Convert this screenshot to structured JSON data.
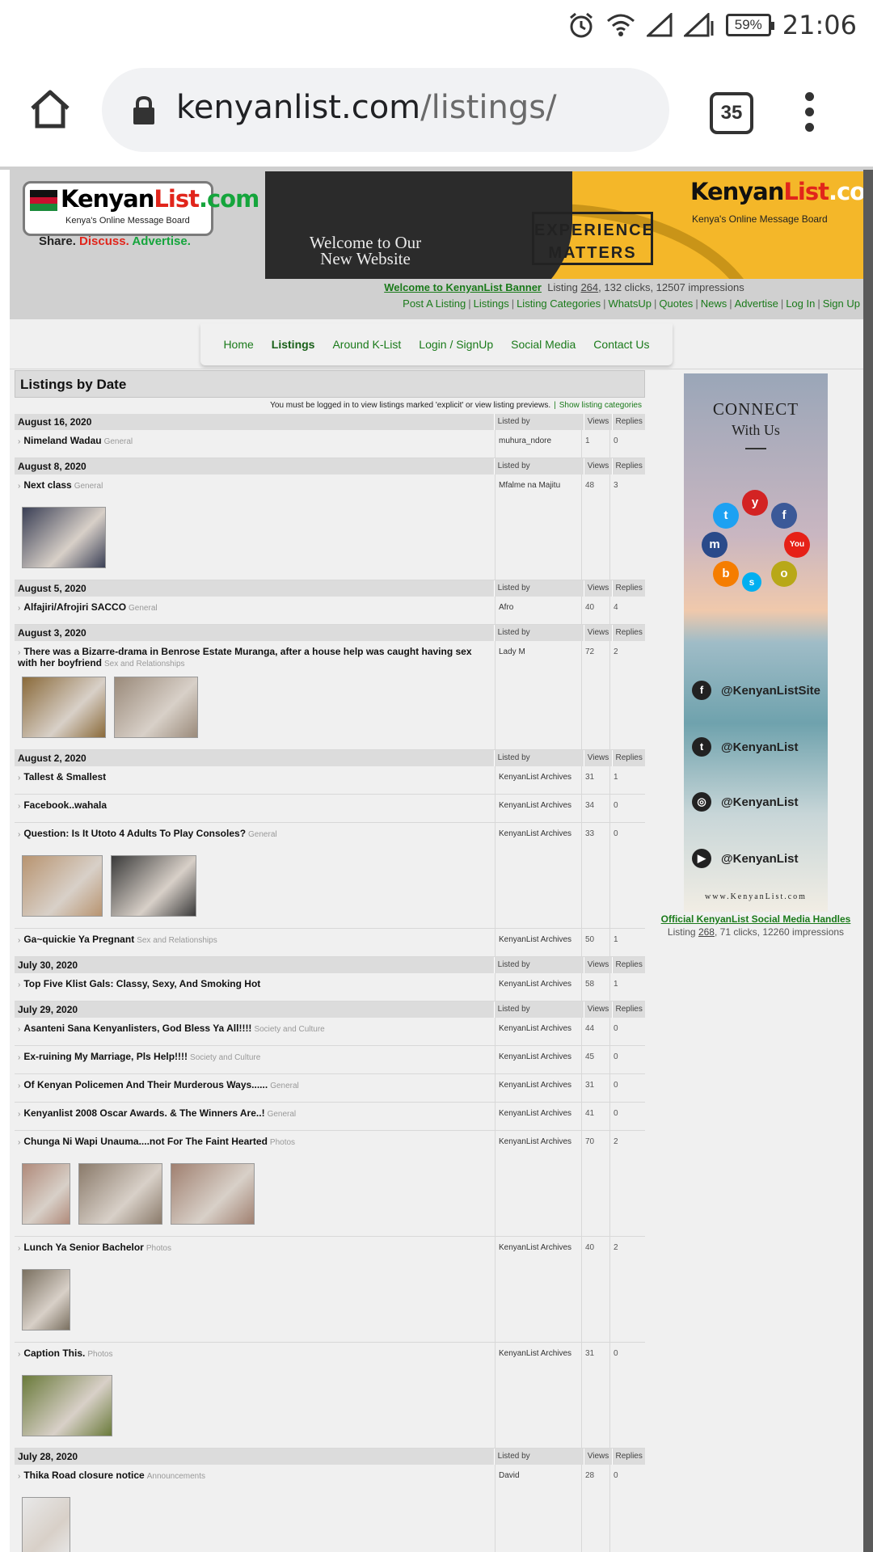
{
  "status_bar": {
    "battery": "59%",
    "time": "21:06"
  },
  "browser": {
    "url_domain": "kenyanlist.com",
    "url_path": "/listings/",
    "tab_count": "35"
  },
  "header": {
    "logo_left": "Kenyan",
    "logo_mid": "List",
    "logo_right": ".com",
    "logo_subtitle": "Kenya's Online Message Board",
    "tagline_share": "Share.",
    "tagline_discuss": "Discuss.",
    "tagline_advertise": "Advertise.",
    "banner": {
      "welcome": "Welcome to Our New Website",
      "experience": "EXPERIENCE MATTERS",
      "logo_left": "Kenyan",
      "logo_mid": "List",
      "logo_right": ".com",
      "subtitle": "Kenya's Online Message Board"
    },
    "banner_link": "Welcome to KenyanList Banner",
    "banner_stats_prefix": "Listing ",
    "banner_listing_no": "264",
    "banner_stats_suffix": ", 132 clicks, 12507 impressions",
    "top_links": [
      "Post A Listing",
      "Listings",
      "Listing Categories",
      "WhatsUp",
      "Quotes",
      "News",
      "Advertise",
      "Log In",
      "Sign Up"
    ]
  },
  "nav": [
    {
      "label": "Home",
      "active": false
    },
    {
      "label": "Listings",
      "active": true
    },
    {
      "label": "Around K-List",
      "active": false
    },
    {
      "label": "Login / SignUp",
      "active": false
    },
    {
      "label": "Social Media",
      "active": false
    },
    {
      "label": "Contact Us",
      "active": false
    }
  ],
  "listings": {
    "title": "Listings by Date",
    "notice": "You must be logged in to view listings marked 'explicit' or view listing previews.",
    "notice_link": "Show listing categories",
    "col_listed_by": "Listed by",
    "col_views": "Views",
    "col_replies": "Replies",
    "groups": [
      {
        "date": "August 16, 2020",
        "items": [
          {
            "title": "Nimeland Wadau",
            "category": "General",
            "by": "muhura_ndore",
            "views": "1",
            "replies": "0",
            "thumbs": []
          }
        ]
      },
      {
        "date": "August 8, 2020",
        "items": [
          {
            "title": "Next class",
            "category": "General",
            "by": "Mfalme na Majitu",
            "views": "48",
            "replies": "3",
            "thumbs": [
              {
                "w": 104,
                "c": "#3a3f55"
              }
            ]
          }
        ]
      },
      {
        "date": "August 5, 2020",
        "items": [
          {
            "title": "Alfajiri/Afrojiri SACCO",
            "category": "General",
            "by": "Afro",
            "views": "40",
            "replies": "4",
            "thumbs": []
          }
        ]
      },
      {
        "date": "August 3, 2020",
        "items": [
          {
            "title": "There was a Bizarre-drama in Benrose Estate Muranga, after a house help was caught having sex with her boyfriend",
            "category": "Sex and Relationships",
            "by": "Lady M",
            "views": "72",
            "replies": "2",
            "thumbs": [
              {
                "w": 104,
                "c": "#8a6a3a"
              },
              {
                "w": 104,
                "c": "#9a8a7a"
              }
            ]
          }
        ]
      },
      {
        "date": "August 2, 2020",
        "items": [
          {
            "title": "Tallest & Smallest",
            "category": "",
            "by": "KenyanList Archives",
            "views": "31",
            "replies": "1",
            "thumbs": []
          },
          {
            "title": "Facebook..wahala",
            "category": "",
            "by": "KenyanList Archives",
            "views": "34",
            "replies": "0",
            "thumbs": []
          },
          {
            "title": "Question: Is It Utoto 4 Adults To Play Consoles?",
            "category": "General",
            "by": "KenyanList Archives",
            "views": "33",
            "replies": "0",
            "thumbs": [
              {
                "w": 100,
                "c": "#b89470"
              },
              {
                "w": 106,
                "c": "#3a3a3a"
              }
            ]
          },
          {
            "title": "Ga~quickie Ya Pregnant",
            "category": "Sex and Relationships",
            "by": "KenyanList Archives",
            "views": "50",
            "replies": "1",
            "thumbs": []
          }
        ]
      },
      {
        "date": "July 30, 2020",
        "items": [
          {
            "title": "Top Five Klist Gals: Classy, Sexy, And Smoking Hot",
            "category": "",
            "by": "KenyanList Archives",
            "views": "58",
            "replies": "1",
            "thumbs": []
          }
        ]
      },
      {
        "date": "July 29, 2020",
        "items": [
          {
            "title": "Asanteni Sana Kenyanlisters, God Bless Ya All!!!!",
            "category": "Society and Culture",
            "by": "KenyanList Archives",
            "views": "44",
            "replies": "0",
            "thumbs": []
          },
          {
            "title": "Ex-ruining My Marriage, Pls Help!!!!",
            "category": "Society and Culture",
            "by": "KenyanList Archives",
            "views": "45",
            "replies": "0",
            "thumbs": []
          },
          {
            "title": "Of Kenyan Policemen And Their Murderous Ways......",
            "category": "General",
            "by": "KenyanList Archives",
            "views": "31",
            "replies": "0",
            "thumbs": []
          },
          {
            "title": "Kenyanlist 2008 Oscar Awards. & The Winners Are..!",
            "category": "General",
            "by": "KenyanList Archives",
            "views": "41",
            "replies": "0",
            "thumbs": []
          },
          {
            "title": "Chunga Ni Wapi Unauma....not For The Faint Hearted",
            "category": "Photos",
            "by": "KenyanList Archives",
            "views": "70",
            "replies": "2",
            "thumbs": [
              {
                "w": 60,
                "c": "#b08a7a"
              },
              {
                "w": 104,
                "c": "#8a7a6a"
              },
              {
                "w": 104,
                "c": "#a08070"
              }
            ]
          },
          {
            "title": "Lunch Ya Senior Bachelor",
            "category": "Photos",
            "by": "KenyanList Archives",
            "views": "40",
            "replies": "2",
            "thumbs": [
              {
                "w": 60,
                "c": "#7a7060"
              }
            ]
          },
          {
            "title": "Caption This.",
            "category": "Photos",
            "by": "KenyanList Archives",
            "views": "31",
            "replies": "0",
            "thumbs": [
              {
                "w": 112,
                "c": "#6a7a3a"
              }
            ]
          }
        ]
      },
      {
        "date": "July 28, 2020",
        "items": [
          {
            "title": "Thika Road closure notice",
            "category": "Announcements",
            "by": "David",
            "views": "28",
            "replies": "0",
            "thumbs": [
              {
                "w": 60,
                "c": "#e8e8e8"
              }
            ]
          }
        ]
      }
    ]
  },
  "sidebar": {
    "ad_connect": "CONNECT",
    "ad_with_us": "With Us",
    "handles": [
      {
        "icon": "facebook-icon",
        "glyph": "f",
        "text": "@KenyanListSite"
      },
      {
        "icon": "twitter-icon",
        "glyph": "t",
        "text": "@KenyanList"
      },
      {
        "icon": "instagram-icon",
        "glyph": "◎",
        "text": "@KenyanList"
      },
      {
        "icon": "youtube-icon",
        "glyph": "▶",
        "text": "@KenyanList"
      }
    ],
    "ad_site": "www.KenyanList.com",
    "link": "Official KenyanList Social Media Handles",
    "stats_prefix": "Listing ",
    "stats_listing_no": "268",
    "stats_suffix": ", 71 clicks, 12260 impressions"
  }
}
